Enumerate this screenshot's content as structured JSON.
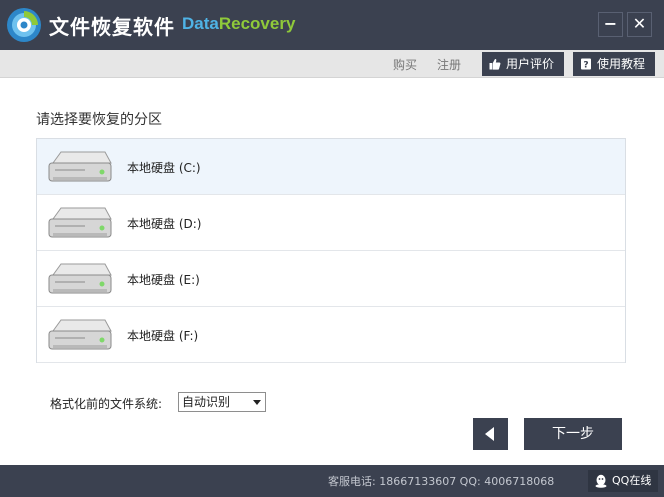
{
  "app": {
    "title": "文件恢复软件",
    "brand_part1": "Data",
    "brand_part2": "Recovery",
    "minimize_glyph": "−",
    "close_glyph": "✕"
  },
  "toolbar": {
    "buy": "购买",
    "register": "注册",
    "review": "用户评价",
    "review_icon": "thumbs-up-icon",
    "tutorial": "使用教程",
    "tutorial_icon": "help-book-icon"
  },
  "main": {
    "section_title": "请选择要恢复的分区",
    "partitions": [
      {
        "label": "本地硬盘 (C:)",
        "selected": true
      },
      {
        "label": "本地硬盘 (D:)",
        "selected": false
      },
      {
        "label": "本地硬盘 (E:)",
        "selected": false
      },
      {
        "label": "本地硬盘 (F:)",
        "selected": false
      }
    ],
    "fs_label": "格式化前的文件系统:",
    "fs_value": "自动识别",
    "next_label": "下一步"
  },
  "footer": {
    "support": "客服电话: 18667133607 QQ: 4006718068",
    "qq_label": "QQ在线"
  },
  "colors": {
    "titlebar": "#3b4150",
    "brand_blue": "#4fb3e6",
    "brand_green": "#8fc93a",
    "selected_row": "#eef5fc"
  }
}
